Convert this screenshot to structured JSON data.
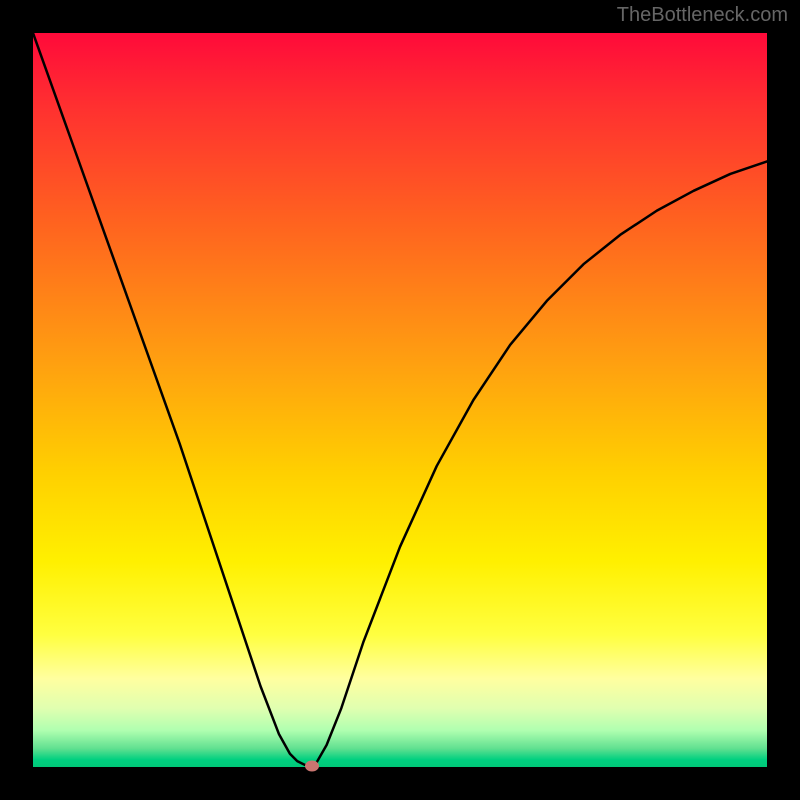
{
  "watermark": "TheBottleneck.com",
  "chart_data": {
    "type": "line",
    "title": "",
    "xlabel": "",
    "ylabel": "",
    "xlim": [
      0,
      100
    ],
    "ylim": [
      0,
      100
    ],
    "grid": false,
    "legend": false,
    "series": [
      {
        "name": "bottleneck-curve",
        "x": [
          0,
          5,
          10,
          15,
          20,
          24,
          28,
          31,
          33.5,
          35,
          36,
          37,
          37.8,
          38.4,
          40,
          42,
          45,
          50,
          55,
          60,
          65,
          70,
          75,
          80,
          85,
          90,
          95,
          100
        ],
        "y": [
          100,
          86,
          72,
          58,
          44,
          32,
          20,
          11,
          4.5,
          1.8,
          0.8,
          0.3,
          0.15,
          0.2,
          3,
          8,
          17,
          30,
          41,
          50,
          57.5,
          63.5,
          68.5,
          72.5,
          75.8,
          78.5,
          80.8,
          82.5
        ]
      }
    ],
    "marker": {
      "x": 38,
      "y": 0.2,
      "color": "#c97570"
    },
    "gradient": {
      "top": "#ff0a3a",
      "mid": "#fff000",
      "bottom": "#00c878"
    }
  }
}
